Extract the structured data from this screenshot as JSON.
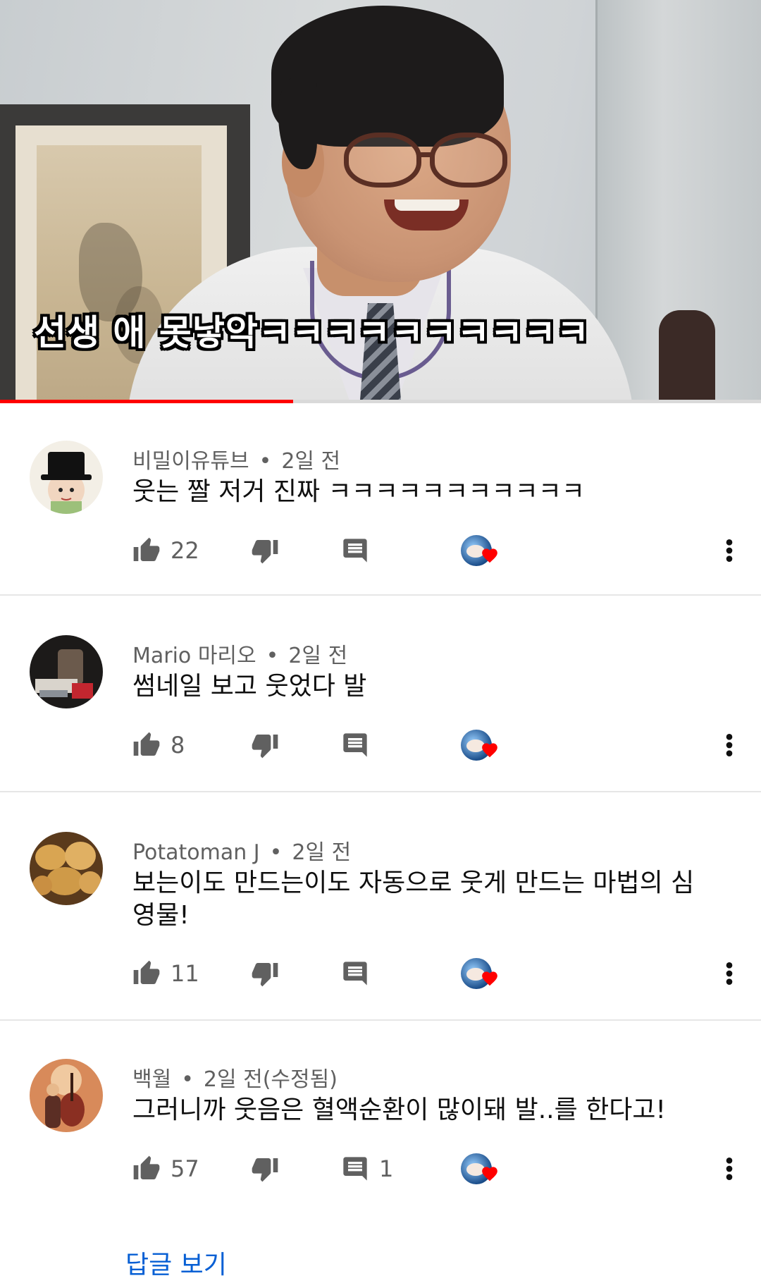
{
  "video": {
    "subtitle": "선생 애 못낳악ㅋㅋㅋㅋㅋㅋㅋㅋㅋㅋ",
    "progress_fraction": 0.385,
    "progress_color": "#ff0000"
  },
  "comments": [
    {
      "author": "비밀이유튜브",
      "time": "2일 전",
      "text": "웃는 짤 저거 진짜 ㅋㅋㅋㅋㅋㅋㅋㅋㅋㅋㅋ",
      "likes": "22",
      "replies": "",
      "avatar": "top-hat-cartoon-avatar",
      "creator_hearted": true
    },
    {
      "author": "Mario 마리오",
      "time": "2일 전",
      "text": "썸네일 보고 웃었다 발",
      "likes": "8",
      "replies": "",
      "avatar": "desk-photo-avatar",
      "creator_hearted": true
    },
    {
      "author": "Potatoman J",
      "time": "2일 전",
      "text": "보는이도 만드는이도 자동으로 웃게 만드는 마법의 심영물!",
      "likes": "11",
      "replies": "",
      "avatar": "potatoes-avatar",
      "creator_hearted": true
    },
    {
      "author": "백월",
      "time": "2일 전(수정됨)",
      "text": "그러니까 웃음은 혈액순환이 많이돼 발..를 한다고!",
      "likes": "57",
      "replies": "1",
      "avatar": "musician-illustration-avatar",
      "creator_hearted": true
    }
  ],
  "view_replies_label": "답글 보기",
  "icons": {
    "like": "thumb-up-icon",
    "dislike": "thumb-down-icon",
    "reply": "comment-icon",
    "heart": "heart-icon",
    "more": "more-vert-icon"
  },
  "colors": {
    "accent_blue": "#065fd4",
    "heart_red": "#ff0000",
    "secondary_text": "#606060"
  }
}
